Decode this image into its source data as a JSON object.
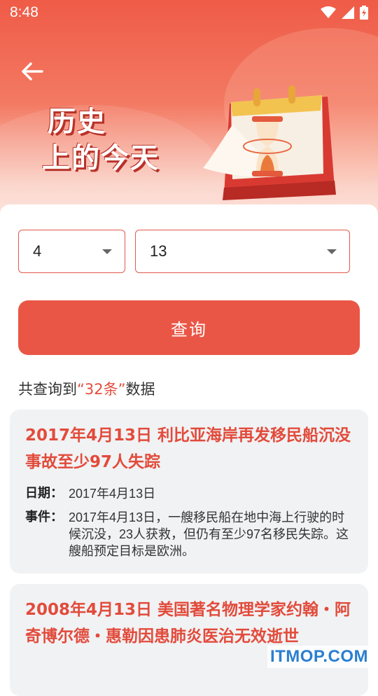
{
  "status_bar": {
    "time": "8:48"
  },
  "hero": {
    "title_line1": "历史",
    "title_line2": "上的今天"
  },
  "selectors": {
    "month_value": "4",
    "day_value": "13"
  },
  "query_button": {
    "label": "查询"
  },
  "result_summary": {
    "prefix": "共查询到",
    "count_text": "“32条”",
    "suffix": "数据"
  },
  "results": [
    {
      "title": "2017年4月13日 利比亚海岸再发移民船沉没事故至少97人失踪",
      "date_label": "日期：",
      "date": "2017年4月13日",
      "event_label": "事件：",
      "event": "2017年4月13日，一艘移民船在地中海上行驶的时候沉没，23人获救，但仍有至少97名移民失踪。这艘船预定目标是欧洲。"
    },
    {
      "title": "2008年4月13日 美国著名物理学家约翰・阿奇博尔德・惠勒因患肺炎医治无效逝世"
    }
  ],
  "watermark": "ITMOP.COM",
  "colors": {
    "accent": "#ea5646",
    "title_red": "#e24b3b"
  }
}
